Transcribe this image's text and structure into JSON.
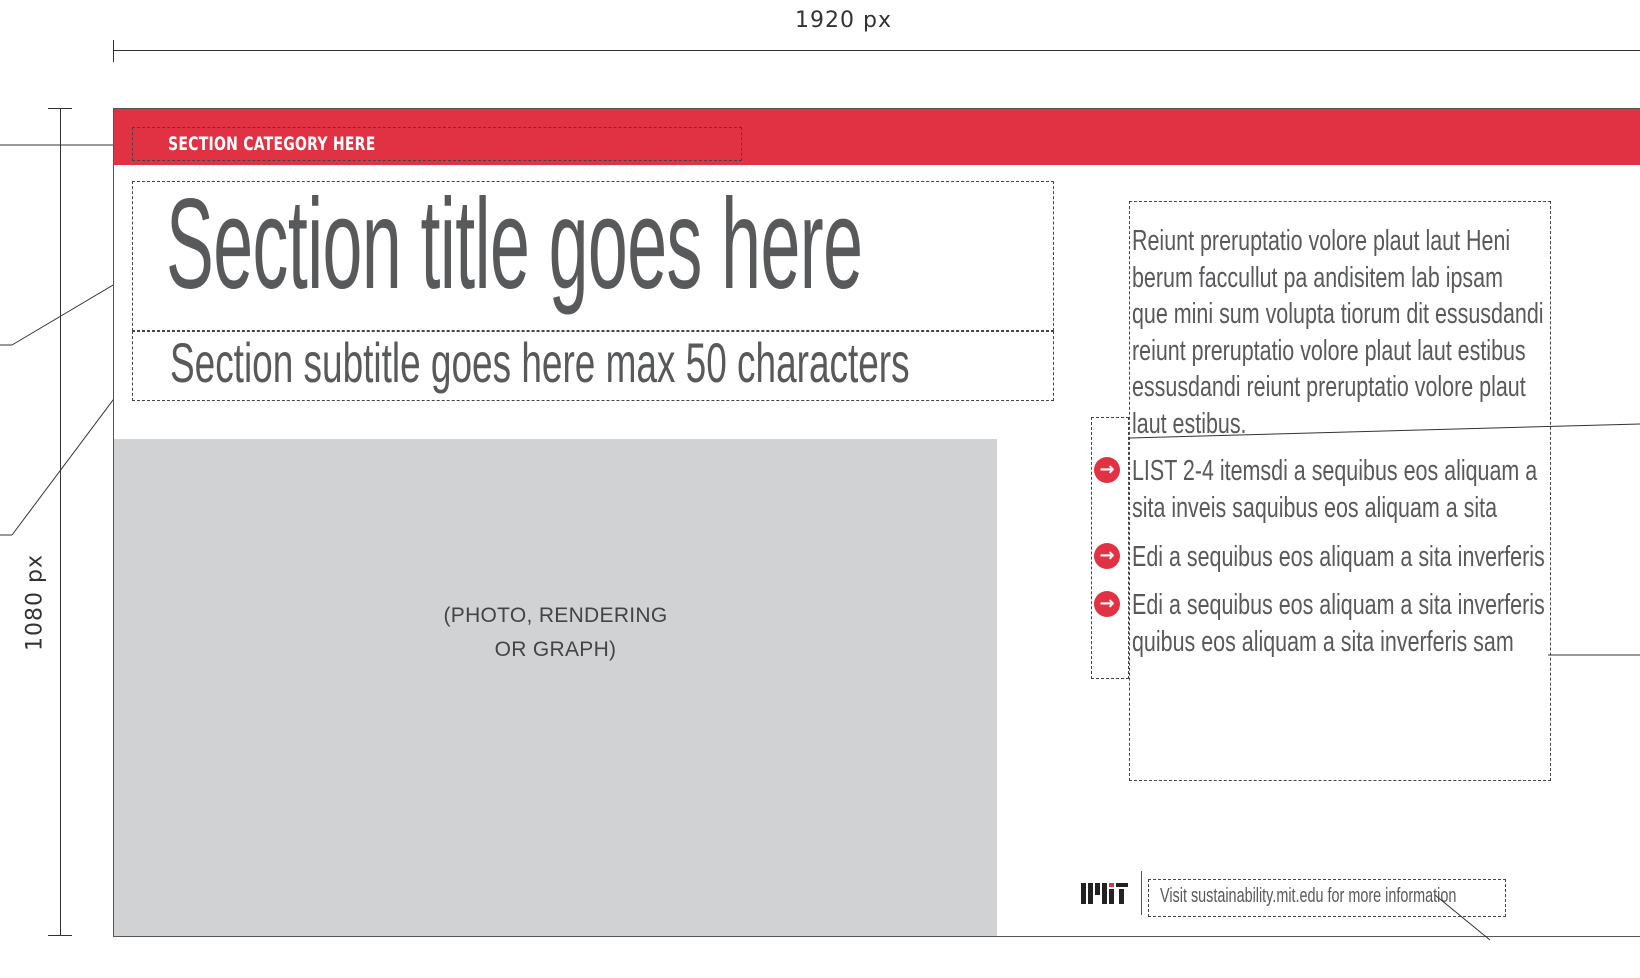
{
  "dimensions": {
    "width_label": "1920 px",
    "height_label": "1080 px"
  },
  "slide": {
    "category": "SECTION CATEGORY HERE",
    "title": "Section title goes here",
    "subtitle": "Section subtitle goes here max 50 characters",
    "photo_label_line1": "(PHOTO, RENDERING",
    "photo_label_line2": "OR GRAPH)",
    "body_lines": [
      "Reiunt preruptatio volore plaut laut Heni",
      "berum faccullut pa andisitem lab ipsam",
      "que mini sum volupta tiorum dit essusdandi",
      "reiunt preruptatio volore plaut laut estibus",
      "essusdandi reiunt preruptatio volore plaut",
      "laut estibus."
    ],
    "list_items": [
      [
        "LIST 2-4 itemsdi a sequibus eos aliquam a",
        "sita inveis saquibus eos aliquam a sita"
      ],
      [
        "Edi a sequibus eos aliquam a sita inverferis"
      ],
      [
        "Edi a sequibus eos aliquam a sita inverferis",
        "quibus eos aliquam a sita inverferis sam"
      ]
    ],
    "footer_text": "Visit sustainability.mit.edu for more information",
    "logo": "MIT"
  },
  "colors": {
    "accent": "#e03243",
    "text_gray": "#58595b",
    "photo_gray": "#d1d2d4"
  }
}
